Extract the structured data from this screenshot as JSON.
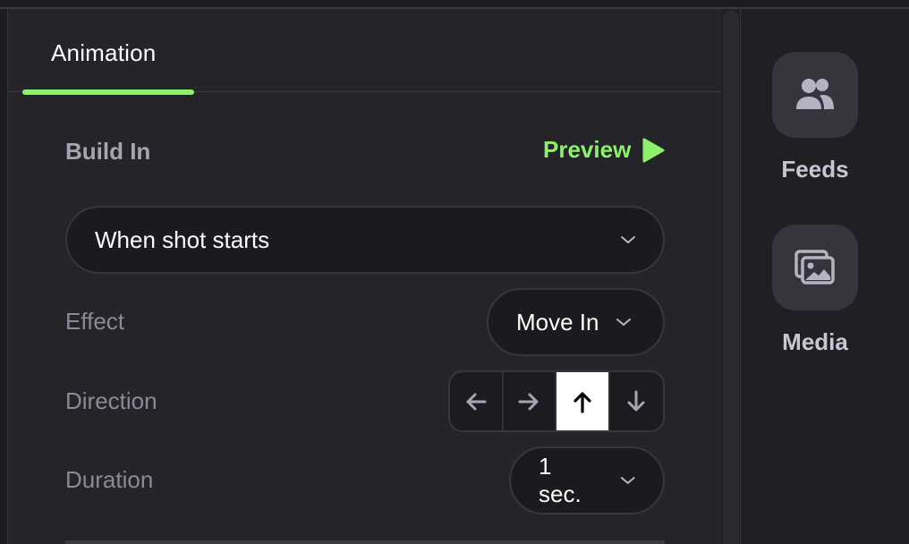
{
  "tabs": [
    {
      "label": "Animation",
      "active": true
    }
  ],
  "build_in": {
    "title": "Build In",
    "preview_label": "Preview",
    "trigger": {
      "value": "When shot starts"
    }
  },
  "effect": {
    "label": "Effect",
    "value": "Move In"
  },
  "direction": {
    "label": "Direction",
    "options": [
      "left",
      "right",
      "up",
      "down"
    ],
    "selected": "up"
  },
  "duration": {
    "label": "Duration",
    "value": "1 sec."
  },
  "sidebar": {
    "items": [
      {
        "label": "Feeds",
        "icon": "people-icon"
      },
      {
        "label": "Media",
        "icon": "images-icon"
      }
    ]
  },
  "colors": {
    "accent": "#8df06b",
    "panel": "#242429",
    "background": "#1c1c21",
    "active_direction": "#ffffff"
  }
}
